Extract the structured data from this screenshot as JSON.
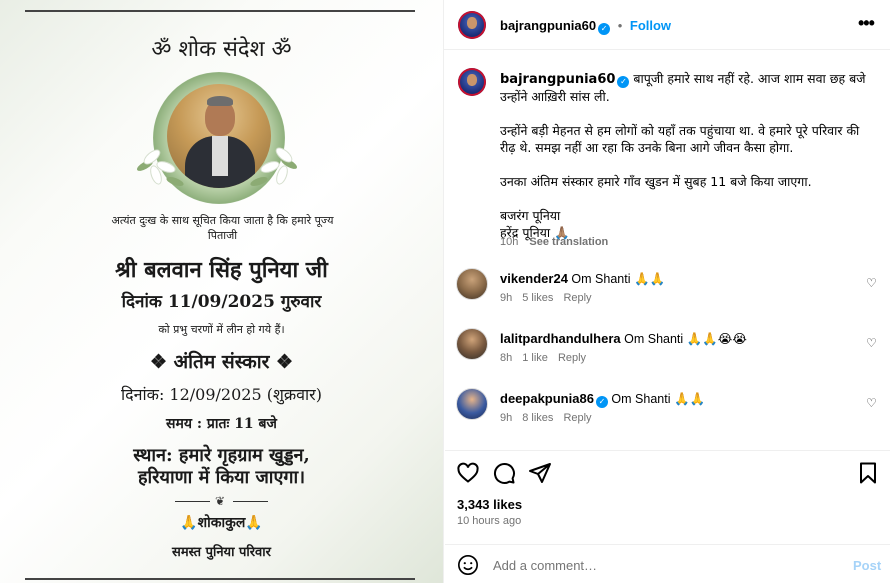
{
  "card": {
    "title": "ॐ शोक संदेश ॐ",
    "intro": "अत्यंत दुःख के साथ सूचित किया जाता है कि हमारे पूज्य पिताजी",
    "name": "श्री बलवान सिंह पुनिया जी",
    "date1": "दिनांक 11/09/2025 गुरुवार",
    "line": "को प्रभु चरणों में लीन हो गये हैं।",
    "rites": "❖ अंतिम संस्कार ❖",
    "date2": "दिनांक: 12/09/2025 (शुक्रवार)",
    "time": "समय : प्रातः 11 बजे",
    "place1": "स्थान: हमारे गृहग्राम खुड्डन,",
    "place2": "हरियाणा में किया जाएगा।",
    "mourn": "🙏शोकाकुल🙏",
    "family": "समस्त पुनिया परिवार"
  },
  "header": {
    "username": "bajrangpunia60",
    "dot": "•",
    "follow": "Follow",
    "more": "•••"
  },
  "caption": {
    "username": "bajrangpunia60",
    "p1": "बापूजी हमारे साथ नहीं रहे. आज शाम सवा छह बजे उन्होंने आख़िरी सांस ली.",
    "p2": "उन्होंने बड़ी मेहनत से हम लोगों को यहाँ तक पहुंचाया था. वे हमारे पूरे परिवार की रीढ़ थे. समझ नहीं आ रहा कि उनके बिना आगे जीवन कैसा होगा.",
    "p3": "उनका अंतिम संस्कार हमारे गाँव खुडन में सुबह 11 बजे किया जाएगा.",
    "sig1": "बजरंग पूनिया",
    "sig2": "हरेंद्र पूनिया 🙏🏽",
    "time": "10h",
    "see_translation": "See translation"
  },
  "comments": [
    {
      "username": "vikender24",
      "verified": false,
      "text": "Om Shanti 🙏🙏",
      "time": "9h",
      "likes": "5 likes",
      "reply": "Reply"
    },
    {
      "username": "lalitpardhandulhera",
      "verified": false,
      "text": "Om Shanti 🙏🙏😭😭",
      "time": "8h",
      "likes": "1 like",
      "reply": "Reply"
    },
    {
      "username": "deepakpunia86",
      "verified": true,
      "text": "Om Shanti 🙏🙏",
      "time": "9h",
      "likes": "8 likes",
      "reply": "Reply"
    }
  ],
  "stats": {
    "likes": "3,343 likes",
    "ago": "10 hours ago"
  },
  "add_comment": {
    "placeholder": "Add a comment…",
    "post": "Post"
  },
  "icons": [
    "heart-icon",
    "comment-icon",
    "share-icon",
    "save-icon",
    "emoji-icon",
    "more-icon",
    "verified-icon"
  ],
  "colors": {
    "accent": "#0095f6",
    "muted": "#737373",
    "post_disabled": "#a6d3f8"
  }
}
